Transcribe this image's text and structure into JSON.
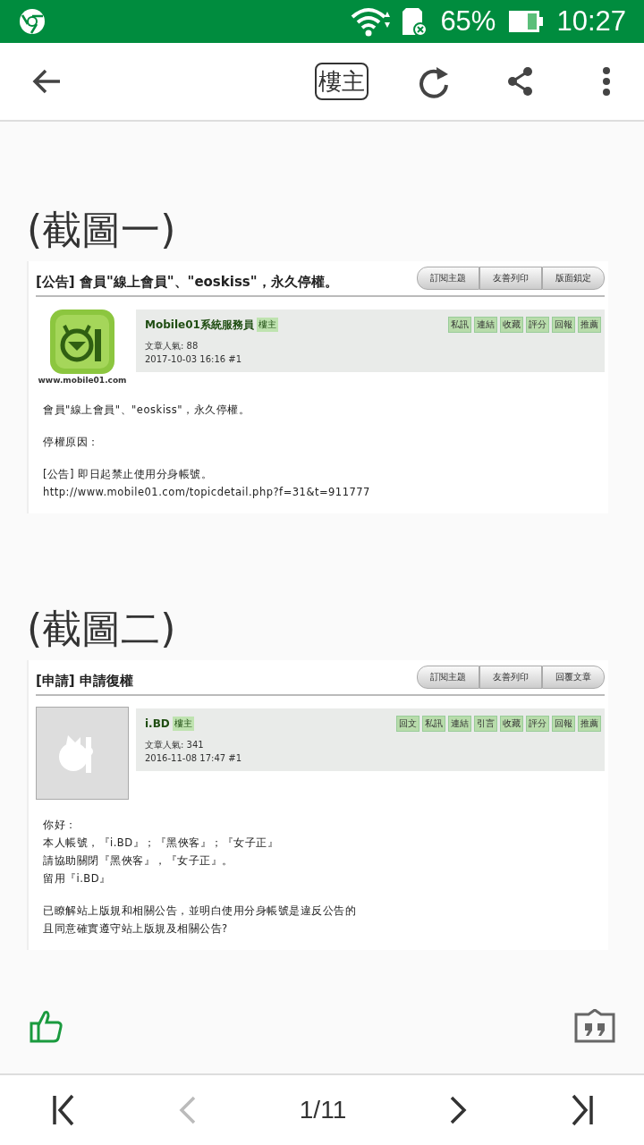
{
  "status_bar": {
    "battery": "65%",
    "time": "10:27"
  },
  "toolbar": {
    "op_button": "樓主"
  },
  "sections": [
    {
      "heading": "(截圖一)",
      "screenshot": {
        "title": "[公告] 會員\"線上會員\"、\"eoskiss\"，永久停權。",
        "buttons": [
          "訂閱主題",
          "友善列印",
          "版面鎖定"
        ],
        "avatar": {
          "kind": "logo",
          "caption": "www.mobile01.com"
        },
        "author": "Mobile01系統服務員",
        "author_badge": "樓主",
        "actions": [
          "私訊",
          "連結",
          "收藏",
          "評分",
          "回報",
          "推薦"
        ],
        "stats": "文章人氣: 88",
        "datetime": "2017-10-03 16:16  #1",
        "paragraphs": [
          [
            "會員\"線上會員\"、\"eoskiss\"，永久停權。"
          ],
          [
            "停權原因："
          ],
          [
            "[公告] 即日起禁止使用分身帳號。",
            "http://www.mobile01.com/topicdetail.php?f=31&t=911777"
          ]
        ]
      }
    },
    {
      "heading": "(截圖二)",
      "screenshot": {
        "title": "[申請] 申請復權",
        "buttons": [
          "訂閱主題",
          "友善列印",
          "回覆文章"
        ],
        "avatar": {
          "kind": "placeholder"
        },
        "author": "i.BD",
        "author_badge": "樓主",
        "actions": [
          "回文",
          "私訊",
          "連結",
          "引言",
          "收藏",
          "評分",
          "回報",
          "推薦"
        ],
        "stats": "文章人氣: 341",
        "datetime": "2016-11-08 17:47  #1",
        "paragraphs": [
          [
            "你好：",
            "本人帳號，『i.BD』；『黑俠客』；『女子正』",
            "請協助關閉『黑俠客』，『女子正』。",
            "留用『i.BD』"
          ],
          [
            "已瞭解站上版規和相關公告，並明白使用分身帳號是違反公告的",
            "且同意確實遵守站上版規及相關公告?"
          ]
        ]
      }
    }
  ],
  "pager": {
    "label": "1/11"
  }
}
